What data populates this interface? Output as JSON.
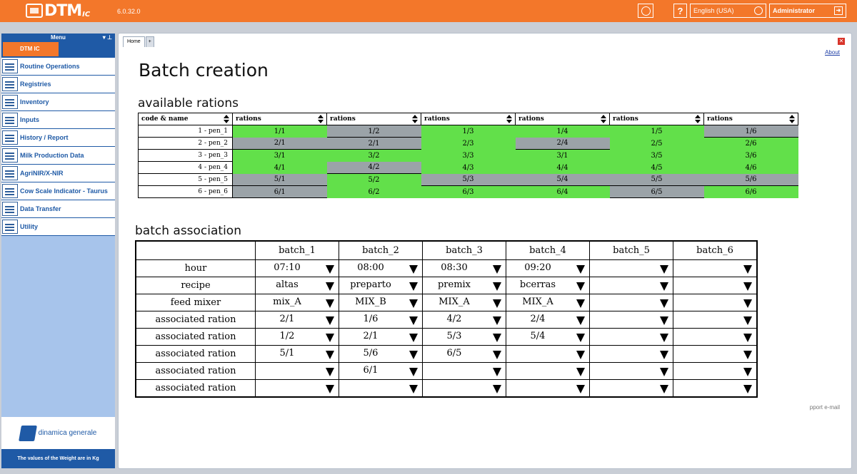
{
  "app": {
    "logo_text": "DTM",
    "logo_sub": "IC",
    "version": "6.0.32.0",
    "language": "English (USA)",
    "user": "Administrator",
    "help_label": "?"
  },
  "sidebar": {
    "menu_title": "Menu",
    "active_tab": "DTM IC",
    "items": [
      {
        "label": "Routine Operations",
        "icon": "calendar-icon"
      },
      {
        "label": "Registries",
        "icon": "registry-icon"
      },
      {
        "label": "Inventory",
        "icon": "inventory-icon"
      },
      {
        "label": "Inputs",
        "icon": "inputs-icon"
      },
      {
        "label": "History / Report",
        "icon": "report-icon"
      },
      {
        "label": "Milk Production Data",
        "icon": "milk-bottle-icon"
      },
      {
        "label": "AgriNIR/X-NIR",
        "icon": "nir-icon"
      },
      {
        "label": "Cow Scale Indicator - Taurus",
        "icon": "cow-icon"
      },
      {
        "label": "Data Transfer",
        "icon": "transfer-icon"
      },
      {
        "label": "Utility",
        "icon": "gears-icon"
      }
    ],
    "brand": "dinamica generale",
    "footer_note": "The values of the Weight are in Kg"
  },
  "main": {
    "tabs": [
      "Home",
      "+"
    ],
    "about_link": "About",
    "title": "Batch creation",
    "email_link": "pport e-mail",
    "rations_section": {
      "heading": "available rations",
      "headers": [
        "code & name",
        "rations",
        "rations",
        "rations",
        "rations",
        "rations",
        "rations"
      ],
      "rows": [
        {
          "pen": "1 - pen_1",
          "cells": [
            {
              "v": "1/1",
              "s": "g"
            },
            {
              "v": "1/2",
              "s": "y"
            },
            {
              "v": "1/3",
              "s": "g"
            },
            {
              "v": "1/4",
              "s": "g"
            },
            {
              "v": "1/5",
              "s": "g"
            },
            {
              "v": "1/6",
              "s": "y"
            }
          ]
        },
        {
          "pen": "2 - pen_2",
          "cells": [
            {
              "v": "2/1",
              "s": "y"
            },
            {
              "v": "2/1",
              "s": "y"
            },
            {
              "v": "2/3",
              "s": "g"
            },
            {
              "v": "2/4",
              "s": "y"
            },
            {
              "v": "2/5",
              "s": "g"
            },
            {
              "v": "2/6",
              "s": "g"
            }
          ]
        },
        {
          "pen": "3 - pen_3",
          "cells": [
            {
              "v": "3/1",
              "s": "g"
            },
            {
              "v": "3/2",
              "s": "g"
            },
            {
              "v": "3/3",
              "s": "g"
            },
            {
              "v": "3/1",
              "s": "g"
            },
            {
              "v": "3/5",
              "s": "g"
            },
            {
              "v": "3/6",
              "s": "g"
            }
          ]
        },
        {
          "pen": "4 - pen_4",
          "cells": [
            {
              "v": "4/1",
              "s": "g"
            },
            {
              "v": "4/2",
              "s": "y"
            },
            {
              "v": "4/3",
              "s": "g"
            },
            {
              "v": "4/4",
              "s": "g"
            },
            {
              "v": "4/5",
              "s": "g"
            },
            {
              "v": "4/6",
              "s": "g"
            }
          ]
        },
        {
          "pen": "5 - pen_5",
          "cells": [
            {
              "v": "5/1",
              "s": "y"
            },
            {
              "v": "5/2",
              "s": "g"
            },
            {
              "v": "5/3",
              "s": "y"
            },
            {
              "v": "5/4",
              "s": "y"
            },
            {
              "v": "5/5",
              "s": "y"
            },
            {
              "v": "5/6",
              "s": "y"
            }
          ]
        },
        {
          "pen": "6 - pen_6",
          "cells": [
            {
              "v": "6/1",
              "s": "y"
            },
            {
              "v": "6/2",
              "s": "g"
            },
            {
              "v": "6/3",
              "s": "g"
            },
            {
              "v": "6/4",
              "s": "g"
            },
            {
              "v": "6/5",
              "s": "y"
            },
            {
              "v": "6/6",
              "s": "g"
            }
          ]
        }
      ]
    },
    "batch_section": {
      "heading": "batch association",
      "batches": [
        "batch_1",
        "batch_2",
        "batch_3",
        "batch_4",
        "batch_5",
        "batch_6"
      ],
      "rows": [
        {
          "label": "hour",
          "values": [
            "07:10",
            "08:00",
            "08:30",
            "09:20",
            "",
            ""
          ]
        },
        {
          "label": "recipe",
          "values": [
            "altas",
            "preparto",
            "premix",
            "bcerras",
            "",
            ""
          ]
        },
        {
          "label": "feed mixer",
          "values": [
            "mix_A",
            "MIX_B",
            "MIX_A",
            "MIX_A",
            "",
            ""
          ]
        },
        {
          "label": "associated ration",
          "values": [
            "2/1",
            "1/6",
            "4/2",
            "2/4",
            "",
            ""
          ]
        },
        {
          "label": "associated ration",
          "values": [
            "1/2",
            "2/1",
            "5/3",
            "5/4",
            "",
            ""
          ]
        },
        {
          "label": "associated ration",
          "values": [
            "5/1",
            "5/6",
            "6/5",
            "",
            "",
            ""
          ]
        },
        {
          "label": "associated ration",
          "values": [
            "",
            "6/1",
            "",
            "",
            "",
            ""
          ]
        },
        {
          "label": "associated ration",
          "values": [
            "",
            "",
            "",
            "",
            "",
            ""
          ]
        }
      ]
    }
  },
  "colors": {
    "orange": "#f3772a",
    "blue": "#1f5aa6",
    "green": "#62e04a",
    "grey": "#9ba3a8"
  }
}
